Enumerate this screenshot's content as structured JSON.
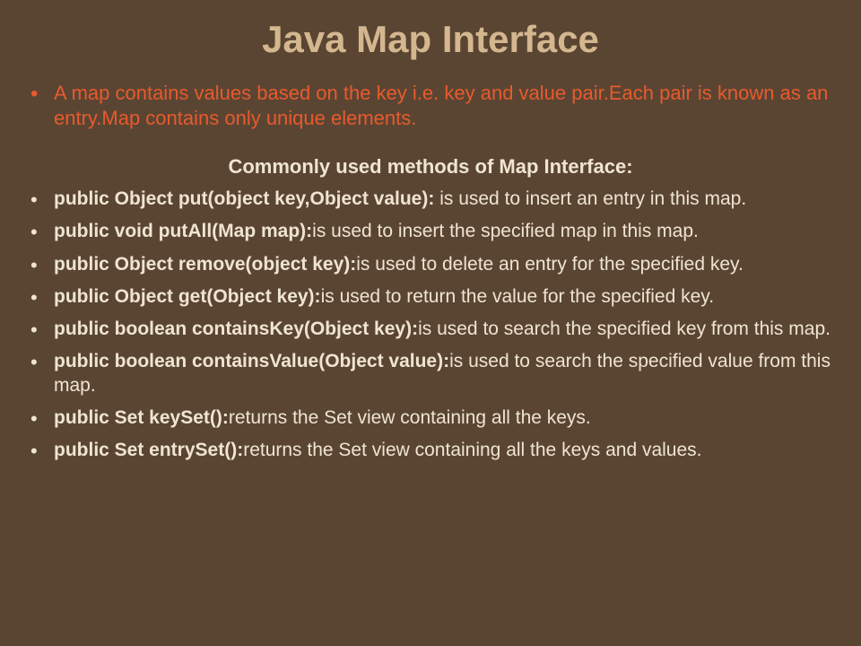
{
  "title": "Java Map Interface",
  "intro": "A map contains values based on the key i.e. key and value pair.Each pair is known as an entry.Map contains only unique elements.",
  "subtitle": "Commonly used methods of Map Interface:",
  "methods": [
    {
      "signature": "public Object put(object key,Object value):",
      "description": " is used to insert an entry in this map."
    },
    {
      "signature": "public void putAll(Map map):",
      "description": "is used to insert the specified map in this map."
    },
    {
      "signature": "public Object remove(object key):",
      "description": "is used to delete an entry for the specified key."
    },
    {
      "signature": "public Object get(Object key):",
      "description": "is used to return the value for the specified key."
    },
    {
      "signature": "public boolean containsKey(Object key):",
      "description": "is used to search the specified key from this map."
    },
    {
      "signature": "public boolean containsValue(Object value):",
      "description": "is used to search the specified value from this map."
    },
    {
      "signature": "public Set keySet():",
      "description": "returns the Set view containing all the keys."
    },
    {
      "signature": "public Set entrySet():",
      "description": "returns the Set view containing all the keys and values."
    }
  ]
}
